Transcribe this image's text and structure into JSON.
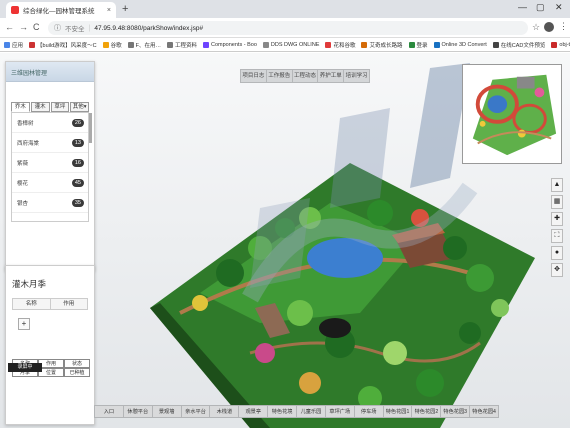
{
  "browser": {
    "tab_title": "综合绿化—园林管理系统",
    "tab_close": "×",
    "new_tab": "+",
    "win_min": "—",
    "win_max": "▢",
    "win_close": "✕",
    "back": "←",
    "forward": "→",
    "reload": "C",
    "insecure": "不安全",
    "url": "47.95.9.48:8080/parkShow/index.jsp#",
    "star": "☆",
    "menu": "⋮"
  },
  "bookmarks": [
    {
      "label": "应用",
      "color": "#4a86e8"
    },
    {
      "label": "【build游戏】风采度～C",
      "color": "#cc3333"
    },
    {
      "label": "谷歌",
      "color": "#f1a20a"
    },
    {
      "label": "F、在用…",
      "color": "#777777"
    },
    {
      "label": "工程资料",
      "color": "#777777"
    },
    {
      "label": "Components - Boo",
      "color": "#6e44ff"
    },
    {
      "label": "DDS DWG ONLINE",
      "color": "#888888"
    },
    {
      "label": "花和谷歌",
      "color": "#e03a3a"
    },
    {
      "label": "艾奇成长路路",
      "color": "#d46b08"
    },
    {
      "label": "登录",
      "color": "#2b8a3e"
    },
    {
      "label": "Online 3D Convert",
      "color": "#1971c2"
    },
    {
      "label": "在线CAD文件预览",
      "color": "#444444"
    },
    {
      "label": "obj-to-json - npm",
      "color": "#c92a2a"
    }
  ],
  "left_panel": {
    "header": "三维园林管理",
    "tabs": [
      "乔木",
      "灌木",
      "草坪",
      "其他▾"
    ],
    "items": [
      {
        "label": "香樟树",
        "count": "26"
      },
      {
        "label": "西府海棠",
        "count": "13"
      },
      {
        "label": "紫薇",
        "count": "16"
      },
      {
        "label": "樱花",
        "count": "45"
      },
      {
        "label": "银杏",
        "count": "35"
      }
    ]
  },
  "shrub_panel": {
    "title": "灌木月季",
    "columns": [
      "名称",
      "作用"
    ],
    "add": "+",
    "footer": [
      "名称",
      "作用",
      "状态",
      "月季",
      "位置",
      "已种植"
    ]
  },
  "toolbar": {
    "items": [
      "项目日志",
      "工作报告",
      "工程动态",
      "养护工单",
      "培训学习"
    ]
  },
  "right_tools": [
    "▲",
    "▦",
    "✚",
    "⛶",
    "●",
    "✥"
  ],
  "bottom_menu": {
    "items": [
      "入口",
      "休憩平台",
      "景观墙",
      "亲水平台",
      "木栈道",
      "观景亭",
      "特色花境",
      "儿童乐园",
      "草坪广场",
      "停车场",
      "特色花园1",
      "特色花园2",
      "特色花园3",
      "特色花园4"
    ]
  },
  "watermark": "风采建科",
  "recording_label": "录屏中"
}
